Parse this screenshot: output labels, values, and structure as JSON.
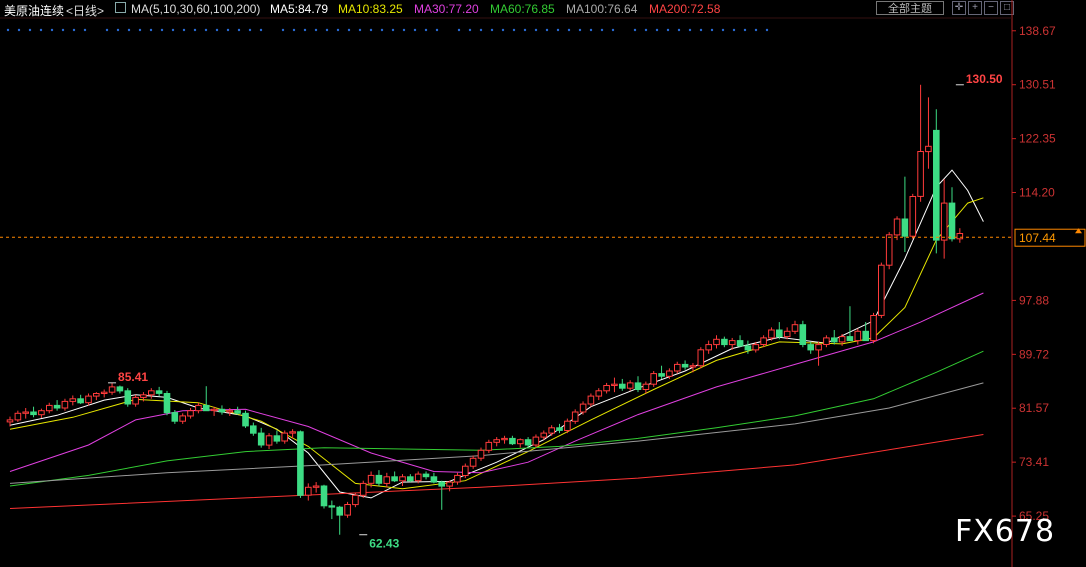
{
  "header": {
    "instrument": "美原油连续",
    "period": "<日线>",
    "ma_params": "MA(5,10,30,60,100,200)",
    "ma5": "MA5:84.79",
    "ma10": "MA10:83.25",
    "ma30": "MA30:77.20",
    "ma60": "MA60:76.85",
    "ma100": "MA100:76.64",
    "ma200": "MA200:72.58",
    "theme_button": "全部主题"
  },
  "colors": {
    "up": "#ff3b3b",
    "down": "#3ddc84",
    "ma5": "#ffffff",
    "ma10": "#e6e600",
    "ma30": "#e040e0",
    "ma60": "#33cc33",
    "ma100": "#9a9a9a",
    "ma200": "#ff3333",
    "axis": "#cc2222",
    "price_line": "#ff8800"
  },
  "icons": [
    "indicator-icon",
    "crosshair-icon",
    "zoom-in-icon",
    "zoom-out-icon",
    "fullscreen-icon"
  ],
  "watermark": "FX678",
  "chart_data": {
    "type": "candlestick",
    "y_ticks": [
      "138.67",
      "130.51",
      "122.35",
      "114.20",
      "97.88",
      "89.72",
      "81.57",
      "73.41",
      "65.25"
    ],
    "y_tick_values": [
      138.67,
      130.51,
      122.35,
      114.2,
      97.88,
      89.72,
      81.57,
      73.41,
      65.25
    ],
    "ylim": [
      63.6,
      140.3
    ],
    "last_price_label": "107.44",
    "last_price": 107.44,
    "annotations": {
      "high": "130.50",
      "high_left": "85.41",
      "low": "62.43"
    },
    "annotation_values": {
      "high": 130.5,
      "high_left": 85.41,
      "low": 62.43
    },
    "candles": [
      [
        79.5,
        80.3,
        78.8,
        79.8
      ],
      [
        79.8,
        81.2,
        79.5,
        80.8
      ],
      [
        80.8,
        81.6,
        80.0,
        81.0
      ],
      [
        81.0,
        81.8,
        80.2,
        80.6
      ],
      [
        80.6,
        81.5,
        80.1,
        81.2
      ],
      [
        81.2,
        82.4,
        80.8,
        82.0
      ],
      [
        82.0,
        82.8,
        81.2,
        81.6
      ],
      [
        81.6,
        83.0,
        81.2,
        82.6
      ],
      [
        82.6,
        83.5,
        82.0,
        83.0
      ],
      [
        83.0,
        83.6,
        82.2,
        82.4
      ],
      [
        82.4,
        83.8,
        82.0,
        83.4
      ],
      [
        83.4,
        84.0,
        82.8,
        83.8
      ],
      [
        83.8,
        84.4,
        83.2,
        84.0
      ],
      [
        84.0,
        85.41,
        83.6,
        84.8
      ],
      [
        84.8,
        85.0,
        83.8,
        84.2
      ],
      [
        84.2,
        84.6,
        81.8,
        82.2
      ],
      [
        82.2,
        83.6,
        81.8,
        83.2
      ],
      [
        83.2,
        84.0,
        82.6,
        83.6
      ],
      [
        83.6,
        84.6,
        83.0,
        84.2
      ],
      [
        84.2,
        84.8,
        83.4,
        83.8
      ],
      [
        83.8,
        84.2,
        80.5,
        80.9
      ],
      [
        80.9,
        81.3,
        79.2,
        79.6
      ],
      [
        79.6,
        80.8,
        79.2,
        80.4
      ],
      [
        80.4,
        81.6,
        80.0,
        81.2
      ],
      [
        81.2,
        82.4,
        80.8,
        82.0
      ],
      [
        82.0,
        84.9,
        81.6,
        81.2
      ],
      [
        81.2,
        81.8,
        80.4,
        81.4
      ],
      [
        81.4,
        82.0,
        80.6,
        81.0
      ],
      [
        81.0,
        81.6,
        80.4,
        81.2
      ],
      [
        81.2,
        81.8,
        80.6,
        80.8
      ],
      [
        80.8,
        81.2,
        78.6,
        78.9
      ],
      [
        78.9,
        79.4,
        77.4,
        77.8
      ],
      [
        77.8,
        78.6,
        75.6,
        76.0
      ],
      [
        76.0,
        77.8,
        75.4,
        77.4
      ],
      [
        77.4,
        78.2,
        76.2,
        76.6
      ],
      [
        76.6,
        78.2,
        76.2,
        77.8
      ],
      [
        77.8,
        78.4,
        77.0,
        78.0
      ],
      [
        78.0,
        78.2,
        68.0,
        68.4
      ],
      [
        68.4,
        70.2,
        67.6,
        69.6
      ],
      [
        69.6,
        70.4,
        68.8,
        69.8
      ],
      [
        69.8,
        70.0,
        66.4,
        66.8
      ],
      [
        66.8,
        67.6,
        64.8,
        66.6
      ],
      [
        66.6,
        66.8,
        62.43,
        65.4
      ],
      [
        65.4,
        67.4,
        65.0,
        67.0
      ],
      [
        67.0,
        68.8,
        66.6,
        68.4
      ],
      [
        68.4,
        70.6,
        68.0,
        70.2
      ],
      [
        70.2,
        72.0,
        69.6,
        71.4
      ],
      [
        71.4,
        72.2,
        69.8,
        70.2
      ],
      [
        70.2,
        71.8,
        69.6,
        71.2
      ],
      [
        71.2,
        72.0,
        70.4,
        70.6
      ],
      [
        70.6,
        71.6,
        69.8,
        71.2
      ],
      [
        71.2,
        71.6,
        70.4,
        70.6
      ],
      [
        70.6,
        72.0,
        70.2,
        71.6
      ],
      [
        71.6,
        72.0,
        70.8,
        71.2
      ],
      [
        71.2,
        71.8,
        70.2,
        70.4
      ],
      [
        70.4,
        70.6,
        66.2,
        69.8
      ],
      [
        69.8,
        70.6,
        69.0,
        70.4
      ],
      [
        70.4,
        71.8,
        70.0,
        71.4
      ],
      [
        71.4,
        73.2,
        71.0,
        72.8
      ],
      [
        72.8,
        74.4,
        72.4,
        74.0
      ],
      [
        74.0,
        75.6,
        73.6,
        75.2
      ],
      [
        75.2,
        76.8,
        74.8,
        76.4
      ],
      [
        76.4,
        77.2,
        75.8,
        76.8
      ],
      [
        76.8,
        77.4,
        76.2,
        77.0
      ],
      [
        77.0,
        77.4,
        76.0,
        76.2
      ],
      [
        76.2,
        77.0,
        75.6,
        76.8
      ],
      [
        76.8,
        77.2,
        75.6,
        76.0
      ],
      [
        76.0,
        77.6,
        75.6,
        77.2
      ],
      [
        77.2,
        78.2,
        76.8,
        77.8
      ],
      [
        77.8,
        79.0,
        77.4,
        78.6
      ],
      [
        78.6,
        79.2,
        77.8,
        78.2
      ],
      [
        78.2,
        80.0,
        77.8,
        79.6
      ],
      [
        79.6,
        81.4,
        79.2,
        81.0
      ],
      [
        81.0,
        82.6,
        80.6,
        82.2
      ],
      [
        82.2,
        83.8,
        81.8,
        83.4
      ],
      [
        83.4,
        84.6,
        82.8,
        84.2
      ],
      [
        84.2,
        85.4,
        83.8,
        85.0
      ],
      [
        85.0,
        86.2,
        84.0,
        85.2
      ],
      [
        85.2,
        86.0,
        84.2,
        84.6
      ],
      [
        84.6,
        85.8,
        84.2,
        85.4
      ],
      [
        85.4,
        86.4,
        84.0,
        84.4
      ],
      [
        84.4,
        85.6,
        83.8,
        85.2
      ],
      [
        85.2,
        87.2,
        84.8,
        86.8
      ],
      [
        86.8,
        88.0,
        86.0,
        86.4
      ],
      [
        86.4,
        87.6,
        86.0,
        87.2
      ],
      [
        87.2,
        88.6,
        86.8,
        88.2
      ],
      [
        88.2,
        88.8,
        87.4,
        87.8
      ],
      [
        87.8,
        88.4,
        87.0,
        88.0
      ],
      [
        88.0,
        90.8,
        87.6,
        90.4
      ],
      [
        90.4,
        91.8,
        89.8,
        91.2
      ],
      [
        91.2,
        92.6,
        90.6,
        92.0
      ],
      [
        92.0,
        92.4,
        90.8,
        91.2
      ],
      [
        91.2,
        92.2,
        90.4,
        91.8
      ],
      [
        91.8,
        92.6,
        90.8,
        91.0
      ],
      [
        91.0,
        91.8,
        89.8,
        90.4
      ],
      [
        90.4,
        91.6,
        90.0,
        91.2
      ],
      [
        91.2,
        92.6,
        90.8,
        92.2
      ],
      [
        92.2,
        93.8,
        91.8,
        93.4
      ],
      [
        93.4,
        94.6,
        92.0,
        92.4
      ],
      [
        92.4,
        93.8,
        92.0,
        93.2
      ],
      [
        93.2,
        94.8,
        92.8,
        94.2
      ],
      [
        94.2,
        94.8,
        90.8,
        91.2
      ],
      [
        91.2,
        91.6,
        89.8,
        90.4
      ],
      [
        90.4,
        91.6,
        88.0,
        91.2
      ],
      [
        91.2,
        92.6,
        90.8,
        92.2
      ],
      [
        92.2,
        93.4,
        91.2,
        91.6
      ],
      [
        91.6,
        92.8,
        91.0,
        92.4
      ],
      [
        92.4,
        97.0,
        92.0,
        91.8
      ],
      [
        91.8,
        93.6,
        91.2,
        93.2
      ],
      [
        93.2,
        94.6,
        92.8,
        91.8
      ],
      [
        91.8,
        96.0,
        91.4,
        95.6
      ],
      [
        95.6,
        103.6,
        95.2,
        103.2
      ],
      [
        103.2,
        108.2,
        102.6,
        107.8
      ],
      [
        107.8,
        110.6,
        107.0,
        110.2
      ],
      [
        110.2,
        116.6,
        105.2,
        107.6
      ],
      [
        107.6,
        114.0,
        107.2,
        113.6
      ],
      [
        113.6,
        130.5,
        112.8,
        120.4
      ],
      [
        120.4,
        128.6,
        117.8,
        121.2
      ],
      [
        123.6,
        126.8,
        105.0,
        107.0
      ],
      [
        107.0,
        116.2,
        104.2,
        112.6
      ],
      [
        112.6,
        115.0,
        106.8,
        107.2
      ],
      [
        107.2,
        108.8,
        106.6,
        108.0
      ]
    ],
    "series": [
      {
        "name": "MA5",
        "values": [
          [
            0,
            79.0
          ],
          [
            6,
            80.5
          ],
          [
            12,
            82.8
          ],
          [
            16,
            83.6
          ],
          [
            20,
            83.2
          ],
          [
            24,
            81.6
          ],
          [
            30,
            80.4
          ],
          [
            34,
            78.4
          ],
          [
            38,
            74.8
          ],
          [
            42,
            68.9
          ],
          [
            46,
            68.0
          ],
          [
            50,
            70.4
          ],
          [
            56,
            70.5
          ],
          [
            62,
            73.4
          ],
          [
            68,
            76.8
          ],
          [
            74,
            81.8
          ],
          [
            80,
            84.6
          ],
          [
            86,
            87.2
          ],
          [
            92,
            90.6
          ],
          [
            98,
            92.3
          ],
          [
            104,
            91.4
          ],
          [
            110,
            94.8
          ],
          [
            114,
            104.2
          ],
          [
            118,
            115.0
          ],
          [
            120,
            117.6
          ],
          [
            122,
            114.5
          ],
          [
            124,
            109.8
          ]
        ]
      },
      {
        "name": "MA10",
        "values": [
          [
            0,
            78.4
          ],
          [
            8,
            80.2
          ],
          [
            16,
            82.9
          ],
          [
            24,
            82.4
          ],
          [
            32,
            79.6
          ],
          [
            38,
            75.8
          ],
          [
            44,
            70.2
          ],
          [
            50,
            69.4
          ],
          [
            58,
            70.6
          ],
          [
            66,
            75.0
          ],
          [
            74,
            79.8
          ],
          [
            82,
            84.4
          ],
          [
            90,
            88.8
          ],
          [
            98,
            91.6
          ],
          [
            106,
            91.3
          ],
          [
            110,
            92.2
          ],
          [
            114,
            96.8
          ],
          [
            118,
            107.0
          ],
          [
            122,
            112.6
          ],
          [
            124,
            113.4
          ]
        ]
      },
      {
        "name": "MA30",
        "values": [
          [
            0,
            72.0
          ],
          [
            10,
            76.0
          ],
          [
            16,
            79.8
          ],
          [
            22,
            81.2
          ],
          [
            30,
            81.4
          ],
          [
            38,
            78.8
          ],
          [
            46,
            74.8
          ],
          [
            54,
            72.0
          ],
          [
            60,
            71.8
          ],
          [
            66,
            73.4
          ],
          [
            72,
            76.6
          ],
          [
            80,
            80.6
          ],
          [
            90,
            84.8
          ],
          [
            100,
            88.2
          ],
          [
            110,
            91.6
          ],
          [
            116,
            94.6
          ],
          [
            124,
            99.0
          ]
        ]
      },
      {
        "name": "MA60",
        "values": [
          [
            0,
            69.8
          ],
          [
            10,
            71.4
          ],
          [
            20,
            73.6
          ],
          [
            30,
            75.0
          ],
          [
            40,
            75.6
          ],
          [
            50,
            75.4
          ],
          [
            60,
            75.2
          ],
          [
            70,
            75.8
          ],
          [
            80,
            77.0
          ],
          [
            90,
            78.6
          ],
          [
            100,
            80.4
          ],
          [
            110,
            83.0
          ],
          [
            118,
            87.0
          ],
          [
            124,
            90.2
          ]
        ]
      },
      {
        "name": "MA100",
        "values": [
          [
            0,
            70.2
          ],
          [
            20,
            71.8
          ],
          [
            40,
            73.0
          ],
          [
            60,
            74.4
          ],
          [
            80,
            76.6
          ],
          [
            100,
            79.2
          ],
          [
            112,
            81.6
          ],
          [
            124,
            85.4
          ]
        ]
      },
      {
        "name": "MA200",
        "values": [
          [
            0,
            66.4
          ],
          [
            30,
            68.0
          ],
          [
            60,
            69.6
          ],
          [
            80,
            71.0
          ],
          [
            100,
            73.0
          ],
          [
            124,
            77.6
          ]
        ]
      }
    ],
    "xlabel": "",
    "ylabel": ""
  }
}
